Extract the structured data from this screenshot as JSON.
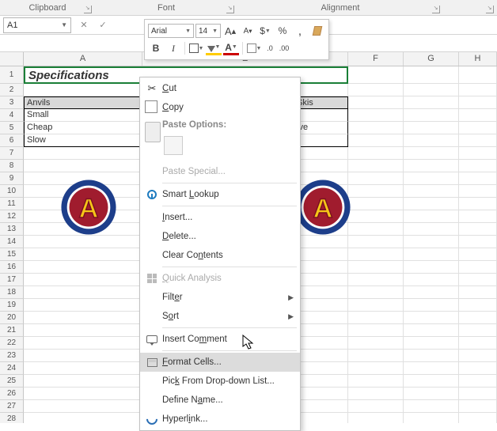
{
  "ribbon": {
    "groups": {
      "clipboard": "Clipboard",
      "font": "Font",
      "alignment": "Alignment"
    }
  },
  "namebox": {
    "value": "A1"
  },
  "mini_toolbar": {
    "font_name": "Arial",
    "font_size": "14",
    "bold": "B",
    "italic": "I",
    "currency": "$",
    "percent": "%",
    "comma": ",",
    "inc_dec": ".0",
    "dec_dec": ".00",
    "grow": "A",
    "shrink": "A"
  },
  "columns": {
    "A": "A",
    "E": "E",
    "F": "F",
    "G": "G",
    "H": "H"
  },
  "rows": [
    "1",
    "2",
    "3",
    "4",
    "5",
    "6",
    "7",
    "8",
    "9",
    "10",
    "11",
    "12",
    "13",
    "14",
    "15",
    "16",
    "17",
    "18",
    "19",
    "20",
    "21",
    "22",
    "23",
    "24",
    "25",
    "26",
    "27",
    "28"
  ],
  "cells": {
    "A1": "Specifications",
    "A3": "Anvils",
    "A4": "Small",
    "A5": "Cheap",
    "A6": "Slow",
    "E3": "Skis",
    "E5": "ive"
  },
  "context_menu": {
    "cut": "Cut",
    "copy": "Copy",
    "paste_options": "Paste Options:",
    "paste_special": "Paste Special...",
    "smart_lookup": "Smart Lookup",
    "insert": "Insert...",
    "delete": "Delete...",
    "clear_contents": "Clear Contents",
    "quick_analysis": "Quick Analysis",
    "filter": "Filter",
    "sort": "Sort",
    "insert_comment": "Insert Comment",
    "format_cells": "Format Cells...",
    "pick_list": "Pick From Drop-down List...",
    "define_name": "Define Name...",
    "hyperlink": "Hyperlink..."
  },
  "logo": {
    "letter": "A"
  }
}
